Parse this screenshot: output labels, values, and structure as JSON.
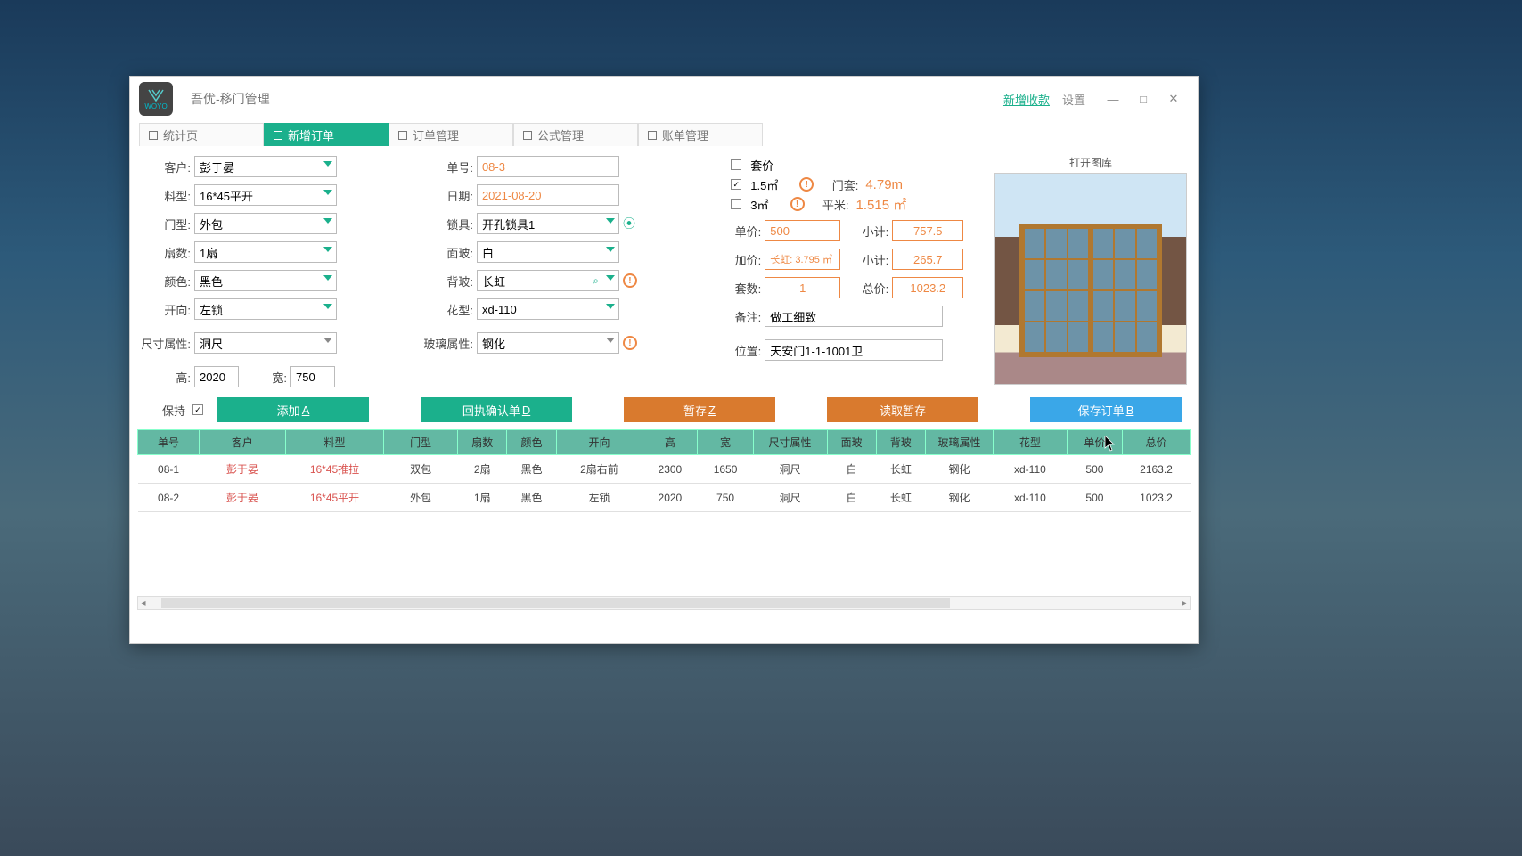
{
  "window": {
    "title": "吾优-移门管理",
    "logo_text": "WOYO",
    "links": {
      "new_payment": "新增收款",
      "settings": "设置"
    }
  },
  "tabs": [
    "统计页",
    "新增订单",
    "订单管理",
    "公式管理",
    "账单管理"
  ],
  "form": {
    "left": {
      "customer_lbl": "客户:",
      "customer": "彭于晏",
      "material_lbl": "料型:",
      "material": "16*45平开",
      "door_type_lbl": "门型:",
      "door_type": "外包",
      "fan_count_lbl": "扇数:",
      "fan_count": "1扇",
      "color_lbl": "颜色:",
      "color": "黑色",
      "direction_lbl": "开向:",
      "direction": "左锁",
      "size_attr_lbl": "尺寸属性:",
      "size_attr": "洞尺",
      "height_lbl": "高:",
      "height": "2020",
      "width_lbl": "宽:",
      "width": "750"
    },
    "mid": {
      "order_no_lbl": "单号:",
      "order_no": "08-3",
      "date_lbl": "日期:",
      "date": "2021-08-20",
      "lock_lbl": "锁具:",
      "lock": "开孔锁具1",
      "front_glass_lbl": "面玻:",
      "front_glass": "白",
      "back_glass_lbl": "背玻:",
      "back_glass": "长虹",
      "pattern_lbl": "花型:",
      "pattern": "xd-110",
      "glass_attr_lbl": "玻璃属性:",
      "glass_attr": "钢化"
    },
    "checks": {
      "set_price_lbl": "套价",
      "set_price": false,
      "area15_lbl": "1.5㎡",
      "area15": true,
      "area3_lbl": "3㎡",
      "area3": false
    },
    "price": {
      "unit_lbl": "单价:",
      "unit": "500",
      "markup_lbl": "加价:",
      "markup": "长虹: 3.795 ㎡",
      "sets_lbl": "套数:",
      "sets": "1",
      "note_lbl": "备注:",
      "note": "做工细致",
      "location_lbl": "位置:",
      "location": "天安门1-1-1001卫"
    },
    "calc": {
      "frame_lbl": "门套:",
      "frame": "4.79m",
      "sqm_lbl": "平米:",
      "sqm": "1.515 ㎡",
      "sub1_lbl": "小计:",
      "sub1": "757.5",
      "sub2_lbl": "小计:",
      "sub2": "265.7",
      "total_lbl": "总价:",
      "total": "1023.2"
    }
  },
  "preview_title": "打开图库",
  "actions": {
    "keep_lbl": "保持",
    "add": "添加 ",
    "add_u": "A",
    "confirm": "回执确认单 ",
    "confirm_u": "D",
    "stash": "暂存 ",
    "stash_u": "Z",
    "load_stash": "读取暂存",
    "save": "保存订单 ",
    "save_u": "B"
  },
  "table": {
    "headers": [
      "单号",
      "客户",
      "料型",
      "门型",
      "扇数",
      "颜色",
      "开向",
      "高",
      "宽",
      "尺寸属性",
      "面玻",
      "背玻",
      "玻璃属性",
      "花型",
      "单价",
      "总价"
    ],
    "rows": [
      [
        "08-1",
        "彭于晏",
        "16*45推拉",
        "双包",
        "2扇",
        "黑色",
        "2扇右前",
        "2300",
        "1650",
        "洞尺",
        "白",
        "长虹",
        "钢化",
        "xd-110",
        "500",
        "2163.2"
      ],
      [
        "08-2",
        "彭于晏",
        "16*45平开",
        "外包",
        "1扇",
        "黑色",
        "左锁",
        "2020",
        "750",
        "洞尺",
        "白",
        "长虹",
        "钢化",
        "xd-110",
        "500",
        "1023.2"
      ]
    ]
  }
}
